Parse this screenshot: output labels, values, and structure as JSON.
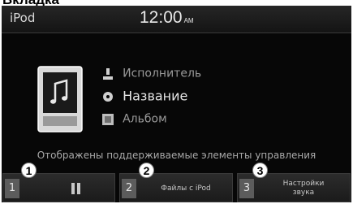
{
  "caption": "Вкладка",
  "status_bar": {
    "source": "iPod",
    "time": "12:00",
    "ampm": "AM"
  },
  "now_playing": {
    "artist": "Исполнитель",
    "title": "Название",
    "album": "Альбом",
    "icons": {
      "device": "ipod-music-icon",
      "artist": "artist-icon",
      "title": "title-icon",
      "album": "album-icon"
    }
  },
  "notice": "Отображены поддерживаемые элементы управления",
  "bottom_bar": [
    {
      "num": "1",
      "icon": "pause-icon"
    },
    {
      "num": "2",
      "label": "Файлы с iPod"
    },
    {
      "num": "3",
      "label_line1": "Настройки",
      "label_line2": "звука"
    }
  ],
  "markers": [
    "1",
    "2",
    "3"
  ]
}
